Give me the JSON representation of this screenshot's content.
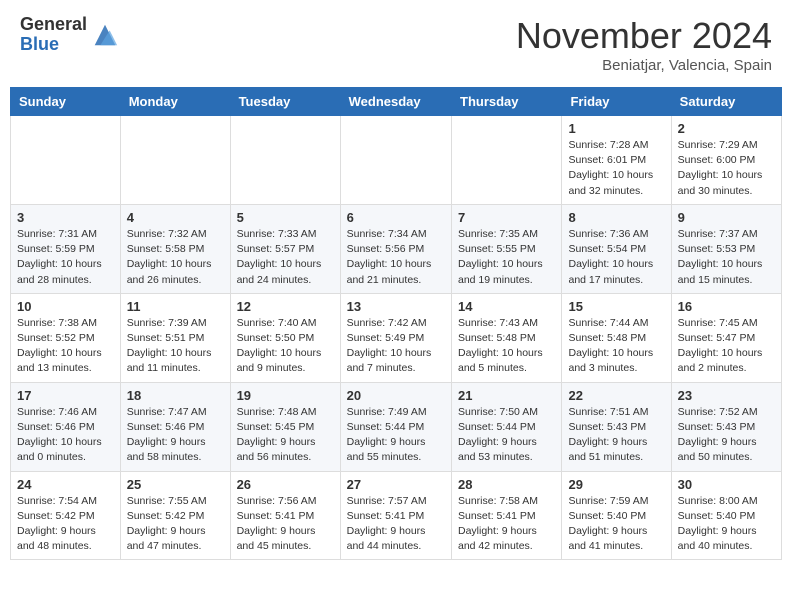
{
  "header": {
    "logo_general": "General",
    "logo_blue": "Blue",
    "month_title": "November 2024",
    "location": "Beniatjar, Valencia, Spain"
  },
  "days_of_week": [
    "Sunday",
    "Monday",
    "Tuesday",
    "Wednesday",
    "Thursday",
    "Friday",
    "Saturday"
  ],
  "weeks": [
    [
      {
        "day": "",
        "info": ""
      },
      {
        "day": "",
        "info": ""
      },
      {
        "day": "",
        "info": ""
      },
      {
        "day": "",
        "info": ""
      },
      {
        "day": "",
        "info": ""
      },
      {
        "day": "1",
        "info": "Sunrise: 7:28 AM\nSunset: 6:01 PM\nDaylight: 10 hours and 32 minutes."
      },
      {
        "day": "2",
        "info": "Sunrise: 7:29 AM\nSunset: 6:00 PM\nDaylight: 10 hours and 30 minutes."
      }
    ],
    [
      {
        "day": "3",
        "info": "Sunrise: 7:31 AM\nSunset: 5:59 PM\nDaylight: 10 hours and 28 minutes."
      },
      {
        "day": "4",
        "info": "Sunrise: 7:32 AM\nSunset: 5:58 PM\nDaylight: 10 hours and 26 minutes."
      },
      {
        "day": "5",
        "info": "Sunrise: 7:33 AM\nSunset: 5:57 PM\nDaylight: 10 hours and 24 minutes."
      },
      {
        "day": "6",
        "info": "Sunrise: 7:34 AM\nSunset: 5:56 PM\nDaylight: 10 hours and 21 minutes."
      },
      {
        "day": "7",
        "info": "Sunrise: 7:35 AM\nSunset: 5:55 PM\nDaylight: 10 hours and 19 minutes."
      },
      {
        "day": "8",
        "info": "Sunrise: 7:36 AM\nSunset: 5:54 PM\nDaylight: 10 hours and 17 minutes."
      },
      {
        "day": "9",
        "info": "Sunrise: 7:37 AM\nSunset: 5:53 PM\nDaylight: 10 hours and 15 minutes."
      }
    ],
    [
      {
        "day": "10",
        "info": "Sunrise: 7:38 AM\nSunset: 5:52 PM\nDaylight: 10 hours and 13 minutes."
      },
      {
        "day": "11",
        "info": "Sunrise: 7:39 AM\nSunset: 5:51 PM\nDaylight: 10 hours and 11 minutes."
      },
      {
        "day": "12",
        "info": "Sunrise: 7:40 AM\nSunset: 5:50 PM\nDaylight: 10 hours and 9 minutes."
      },
      {
        "day": "13",
        "info": "Sunrise: 7:42 AM\nSunset: 5:49 PM\nDaylight: 10 hours and 7 minutes."
      },
      {
        "day": "14",
        "info": "Sunrise: 7:43 AM\nSunset: 5:48 PM\nDaylight: 10 hours and 5 minutes."
      },
      {
        "day": "15",
        "info": "Sunrise: 7:44 AM\nSunset: 5:48 PM\nDaylight: 10 hours and 3 minutes."
      },
      {
        "day": "16",
        "info": "Sunrise: 7:45 AM\nSunset: 5:47 PM\nDaylight: 10 hours and 2 minutes."
      }
    ],
    [
      {
        "day": "17",
        "info": "Sunrise: 7:46 AM\nSunset: 5:46 PM\nDaylight: 10 hours and 0 minutes."
      },
      {
        "day": "18",
        "info": "Sunrise: 7:47 AM\nSunset: 5:46 PM\nDaylight: 9 hours and 58 minutes."
      },
      {
        "day": "19",
        "info": "Sunrise: 7:48 AM\nSunset: 5:45 PM\nDaylight: 9 hours and 56 minutes."
      },
      {
        "day": "20",
        "info": "Sunrise: 7:49 AM\nSunset: 5:44 PM\nDaylight: 9 hours and 55 minutes."
      },
      {
        "day": "21",
        "info": "Sunrise: 7:50 AM\nSunset: 5:44 PM\nDaylight: 9 hours and 53 minutes."
      },
      {
        "day": "22",
        "info": "Sunrise: 7:51 AM\nSunset: 5:43 PM\nDaylight: 9 hours and 51 minutes."
      },
      {
        "day": "23",
        "info": "Sunrise: 7:52 AM\nSunset: 5:43 PM\nDaylight: 9 hours and 50 minutes."
      }
    ],
    [
      {
        "day": "24",
        "info": "Sunrise: 7:54 AM\nSunset: 5:42 PM\nDaylight: 9 hours and 48 minutes."
      },
      {
        "day": "25",
        "info": "Sunrise: 7:55 AM\nSunset: 5:42 PM\nDaylight: 9 hours and 47 minutes."
      },
      {
        "day": "26",
        "info": "Sunrise: 7:56 AM\nSunset: 5:41 PM\nDaylight: 9 hours and 45 minutes."
      },
      {
        "day": "27",
        "info": "Sunrise: 7:57 AM\nSunset: 5:41 PM\nDaylight: 9 hours and 44 minutes."
      },
      {
        "day": "28",
        "info": "Sunrise: 7:58 AM\nSunset: 5:41 PM\nDaylight: 9 hours and 42 minutes."
      },
      {
        "day": "29",
        "info": "Sunrise: 7:59 AM\nSunset: 5:40 PM\nDaylight: 9 hours and 41 minutes."
      },
      {
        "day": "30",
        "info": "Sunrise: 8:00 AM\nSunset: 5:40 PM\nDaylight: 9 hours and 40 minutes."
      }
    ]
  ]
}
